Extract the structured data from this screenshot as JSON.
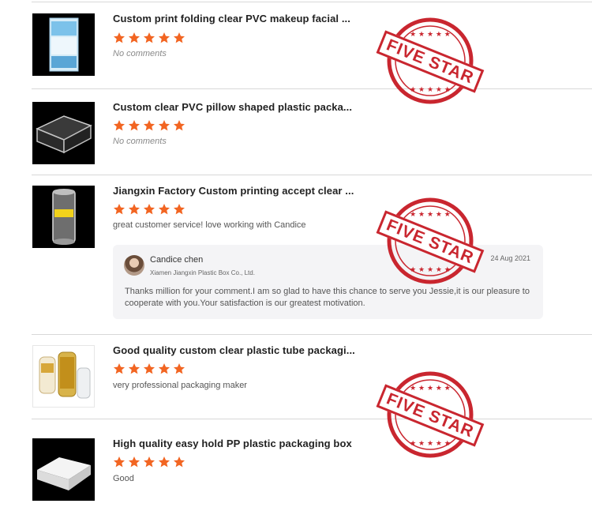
{
  "reviews": [
    {
      "title": "Custom print folding clear PVC makeup facial ...",
      "rating": 5,
      "comment": "No comments"
    },
    {
      "title": "Custom clear PVC pillow shaped plastic packa...",
      "rating": 5,
      "comment": "No comments"
    },
    {
      "title": "Jiangxin Factory Custom printing accept clear ...",
      "rating": 5,
      "comment": "great customer service! love working with Candice"
    },
    {
      "title": "Good quality custom clear plastic tube packagi...",
      "rating": 5,
      "comment": "very professional packaging maker"
    },
    {
      "title": "High quality easy hold PP plastic packaging box",
      "rating": 5,
      "comment": "Good"
    }
  ],
  "reply": {
    "name": "Candice chen",
    "company": "Xiamen Jiangxin Plastic Box Co., Ltd.",
    "date": "24 Aug 2021",
    "text": "Thanks million for your comment.I am so glad  to have this chance to serve you Jessie,it is our pleasure to cooperate with you.Your satisfaction is our greatest motivation."
  },
  "stamps": [
    "FIVE STAR",
    "FIVE STAR",
    "FIVE STAR"
  ],
  "colors": {
    "star": "#f26522",
    "stamp": "#c9262f",
    "divider": "#d8d8d8"
  },
  "icons": {
    "rating": "star-icon"
  }
}
